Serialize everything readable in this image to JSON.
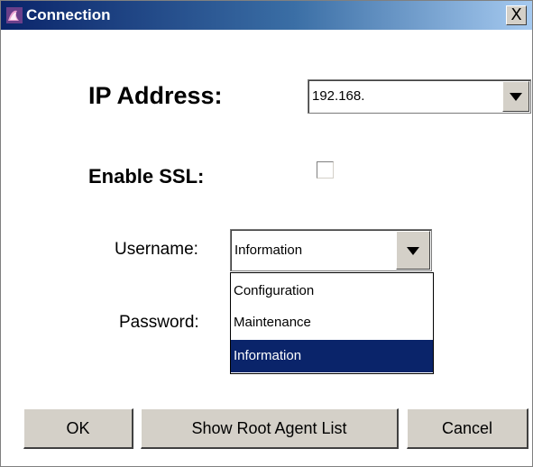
{
  "window": {
    "title": "Connection",
    "close_label": "X"
  },
  "form": {
    "ip_label": "IP Address:",
    "ip_value": "192.168.",
    "ssl_label": "Enable SSL:",
    "ssl_checked": false,
    "username_label": "Username:",
    "username_value": "Information",
    "password_label": "Password:"
  },
  "dropdown": {
    "options": [
      "Configuration",
      "Maintenance",
      "Information"
    ],
    "selected_index": 2
  },
  "buttons": {
    "ok": "OK",
    "root": "Show Root Agent List",
    "cancel": "Cancel"
  },
  "colors": {
    "title_gradient_start": "#0a246a",
    "selection": "#0a246a",
    "face": "#d4d0c8"
  }
}
